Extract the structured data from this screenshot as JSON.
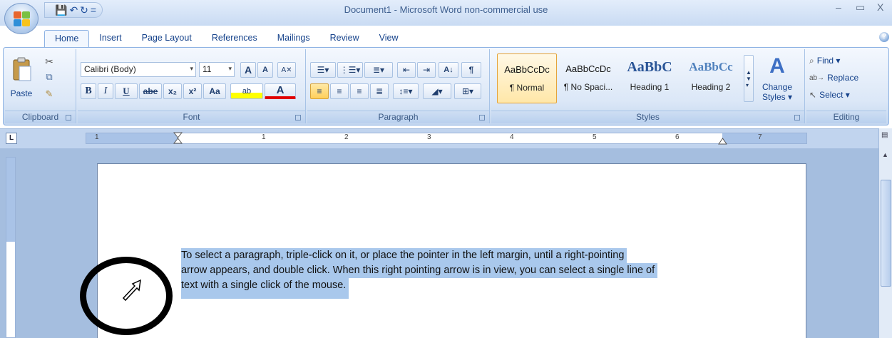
{
  "window": {
    "title": "Document1 - Microsoft Word non-commercial use",
    "minimize": "–",
    "restore": "▭",
    "close": "X"
  },
  "quick_access": {
    "save_icon": "floppy-save-icon",
    "undo_icon": "undo-icon",
    "redo_icon": "redo-icon",
    "customize": "="
  },
  "tabs": [
    "Home",
    "Insert",
    "Page Layout",
    "References",
    "Mailings",
    "Review",
    "View"
  ],
  "active_tab": "Home",
  "ribbon": {
    "clipboard": {
      "label": "Clipboard",
      "paste": "Paste"
    },
    "font": {
      "label": "Font",
      "font_name": "Calibri (Body)",
      "font_size": "11",
      "grow": "A",
      "shrink": "A",
      "bold": "B",
      "italic": "I",
      "underline": "U",
      "strike": "abe",
      "subscript": "x₂",
      "superscript": "x²",
      "change_case": "Aa",
      "highlight": "ab",
      "font_color": "A"
    },
    "paragraph": {
      "label": "Paragraph",
      "sort": "A↓",
      "pilcrow": "¶"
    },
    "styles": {
      "label": "Styles",
      "items": [
        {
          "sample": "AaBbCcDc",
          "name": "¶ Normal"
        },
        {
          "sample": "AaBbCcDc",
          "name": "¶ No Spaci..."
        },
        {
          "sample": "AaBbC",
          "name": "Heading 1"
        },
        {
          "sample": "AaBbCc",
          "name": "Heading 2"
        }
      ],
      "change_styles_line1": "Change",
      "change_styles_line2": "Styles ▾"
    },
    "editing": {
      "label": "Editing",
      "find": "Find ▾",
      "replace": "Replace",
      "select": "Select ▾"
    }
  },
  "ruler": {
    "tab_selector": "L",
    "numbers": [
      "1",
      "1",
      "2",
      "3",
      "4",
      "5",
      "6",
      "7"
    ]
  },
  "document": {
    "lines": [
      "To select a paragraph, triple-click on it, or place the pointer in the left margin, until a right-pointing",
      "arrow appears, and double click.  When this right pointing arrow is in view, you can select a single line of",
      "text with a single click of the mouse."
    ]
  },
  "colors": {
    "accent": "#15428b",
    "ribbon_bg": "#dbe7f7",
    "selection": "#a9c8ec",
    "workspace": "#a5bedf",
    "annotation": "#000000"
  }
}
